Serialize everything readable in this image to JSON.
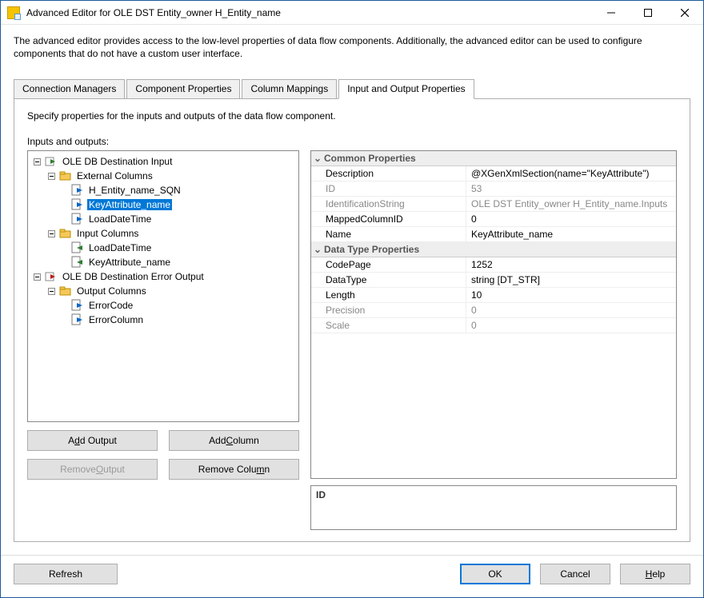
{
  "window": {
    "title": "Advanced Editor for OLE DST Entity_owner H_Entity_name"
  },
  "intro": "The advanced editor provides access to the low-level properties of data flow components. Additionally, the advanced editor can be used to configure components that do not have a custom user interface.",
  "tabs": {
    "t0": "Connection Managers",
    "t1": "Component Properties",
    "t2": "Column Mappings",
    "t3": "Input and Output Properties"
  },
  "panel": {
    "desc": "Specify properties for the inputs and outputs of the data flow component.",
    "subhead": "Inputs and outputs:"
  },
  "tree": {
    "n0": "OLE DB Destination Input",
    "n0_0": "External Columns",
    "n0_0_0": "H_Entity_name_SQN",
    "n0_0_1": "KeyAttribute_name",
    "n0_0_2": "LoadDateTime",
    "n0_1": "Input Columns",
    "n0_1_0": "LoadDateTime",
    "n0_1_1": "KeyAttribute_name",
    "n1": "OLE DB Destination Error Output",
    "n1_0": "Output Columns",
    "n1_0_0": "ErrorCode",
    "n1_0_1": "ErrorColumn"
  },
  "props": {
    "cat_common": "Common Properties",
    "cat_dtp": "Data Type Properties",
    "Description_n": "Description",
    "Description_v": "@XGenXmlSection(name=\"KeyAttribute\")",
    "ID_n": "ID",
    "ID_v": "53",
    "IdentificationString_n": "IdentificationString",
    "IdentificationString_v": "OLE DST Entity_owner H_Entity_name.Inputs",
    "MappedColumnID_n": "MappedColumnID",
    "MappedColumnID_v": "0",
    "Name_n": "Name",
    "Name_v": "KeyAttribute_name",
    "CodePage_n": "CodePage",
    "CodePage_v": "1252",
    "DataType_n": "DataType",
    "DataType_v": "string [DT_STR]",
    "Length_n": "Length",
    "Length_v": "10",
    "Precision_n": "Precision",
    "Precision_v": "0",
    "Scale_n": "Scale",
    "Scale_v": "0",
    "selected_prop": "ID"
  },
  "buttons": {
    "add_output_pre": "A",
    "add_output_ul": "d",
    "add_output_post": "d Output",
    "add_column_pre": "Add ",
    "add_column_ul": "C",
    "add_column_post": "olumn",
    "remove_output_pre": "Remove ",
    "remove_output_ul": "O",
    "remove_output_post": "utput",
    "remove_column_pre": "Remove Colu",
    "remove_column_ul": "m",
    "remove_column_post": "n",
    "refresh": "Refresh",
    "ok": "OK",
    "cancel": "Cancel",
    "help_ul": "H",
    "help_post": "elp"
  }
}
